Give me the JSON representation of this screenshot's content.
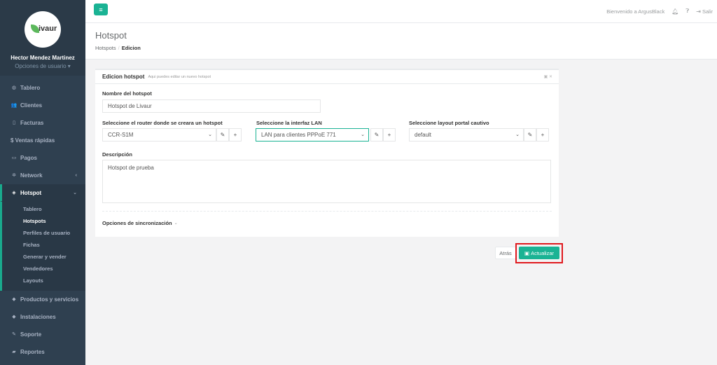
{
  "logo": {
    "text": "ivaur"
  },
  "user": {
    "name": "Hector Mendez Martinez",
    "options": "Opciones de usuario ▾"
  },
  "nav": {
    "tablero": "Tablero",
    "clientes": "Clientes",
    "facturas": "Facturas",
    "ventas": "$ Ventas rápidas",
    "pagos": "Pagos",
    "network": "Network",
    "hotspot": "Hotspot",
    "productos": "Productos y servicios",
    "instalaciones": "Instalaciones",
    "soporte": "Soporte",
    "reportes": "Reportes"
  },
  "subnav": [
    "Tablero",
    "Hotspots",
    "Perfiles de usuario",
    "Fichas",
    "Generar y vender",
    "Vendedores",
    "Layouts"
  ],
  "topbar": {
    "welcome": "Bienvenido a ArgusBlack",
    "logout": "Salir"
  },
  "heading": {
    "title": "Hotspot",
    "crumb1": "Hotspots",
    "crumb2": "Edicion"
  },
  "card": {
    "title": "Edicion hotspot",
    "subtitle": "Aqui puedes editar un nuevo hotspot",
    "name_label": "Nombre del hotspot",
    "name_value": "Hotspot de Livaur",
    "router_label": "Seleccione el router donde se creara un hotspot",
    "router_value": "CCR-S1M",
    "interface_label": "Seleccione la interfaz LAN",
    "interface_value": "LAN para clientes PPPoE 771",
    "layout_label": "Seleccione layout portal cautivo",
    "layout_value": "default",
    "desc_label": "Descripción",
    "desc_value": "Hotspot de prueba",
    "sync_label": "Opciones de sincronización"
  },
  "buttons": {
    "back": "Atrás",
    "update": "Actualizar"
  }
}
